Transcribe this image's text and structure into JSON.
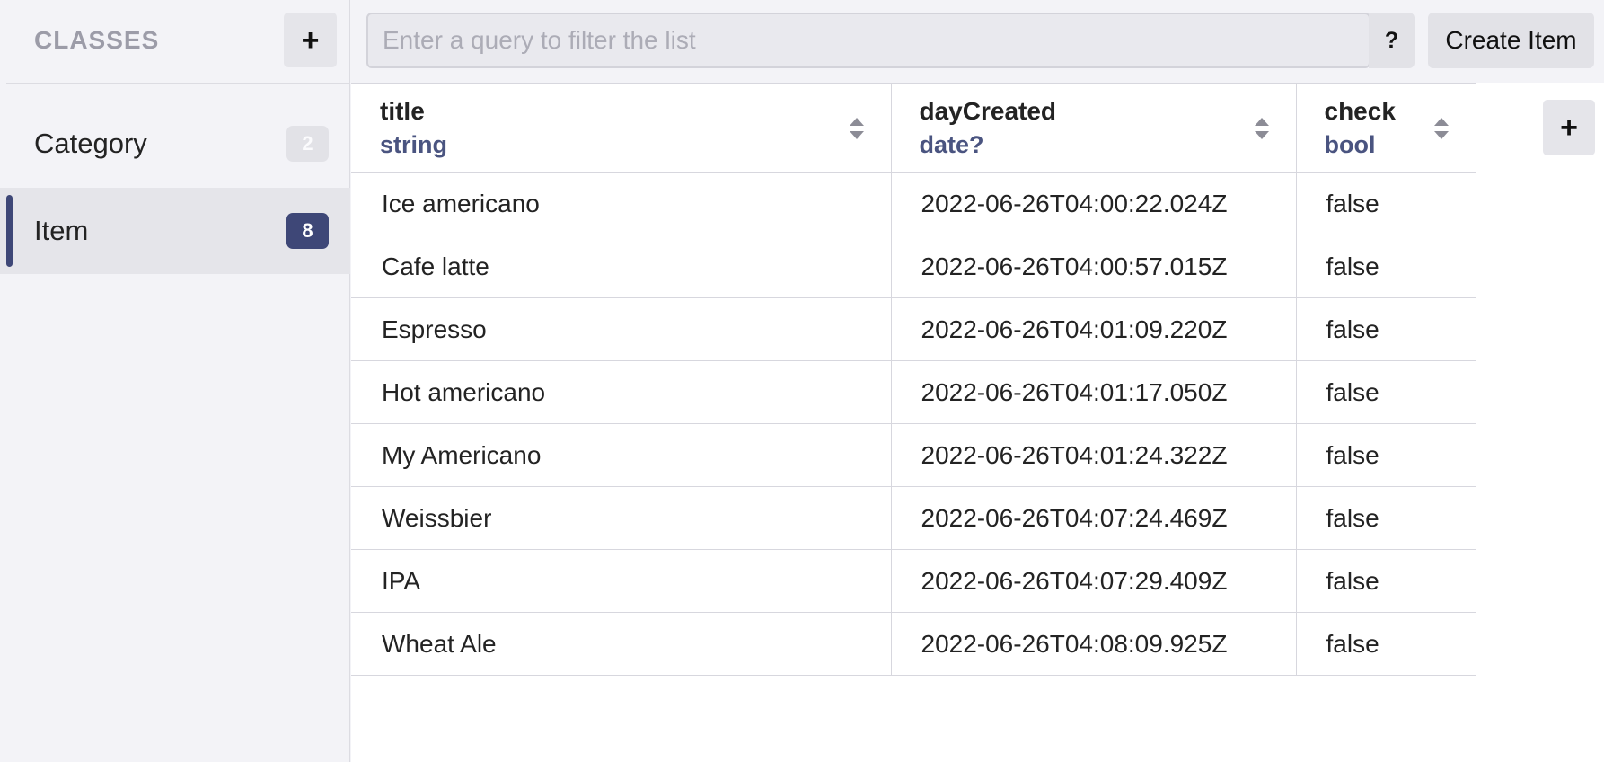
{
  "sidebar": {
    "title": "CLASSES",
    "add_icon": "plus-icon",
    "classes": [
      {
        "label": "Category",
        "count": "2",
        "active": false
      },
      {
        "label": "Item",
        "count": "8",
        "active": true
      }
    ]
  },
  "toolbar": {
    "search_placeholder": "Enter a query to filter the list",
    "search_value": "",
    "help_label": "?",
    "create_label": "Create Item"
  },
  "table": {
    "columns": [
      {
        "name": "title",
        "type": "string"
      },
      {
        "name": "dayCreated",
        "type": "date?"
      },
      {
        "name": "check",
        "type": "bool"
      }
    ],
    "rows": [
      [
        "Ice americano",
        "2022-06-26T04:00:22.024Z",
        "false"
      ],
      [
        "Cafe latte",
        "2022-06-26T04:00:57.015Z",
        "false"
      ],
      [
        "Espresso",
        "2022-06-26T04:01:09.220Z",
        "false"
      ],
      [
        "Hot americano",
        "2022-06-26T04:01:17.050Z",
        "false"
      ],
      [
        "My Americano",
        "2022-06-26T04:01:24.322Z",
        "false"
      ],
      [
        "Weissbier",
        "2022-06-26T04:07:24.469Z",
        "false"
      ],
      [
        "IPA",
        "2022-06-26T04:07:29.409Z",
        "false"
      ],
      [
        "Wheat Ale",
        "2022-06-26T04:08:09.925Z",
        "false"
      ]
    ],
    "add_column_icon": "plus-icon"
  },
  "colors": {
    "accent": "#3e4777",
    "background": "#f3f3f7",
    "type_text": "#4a5480"
  }
}
